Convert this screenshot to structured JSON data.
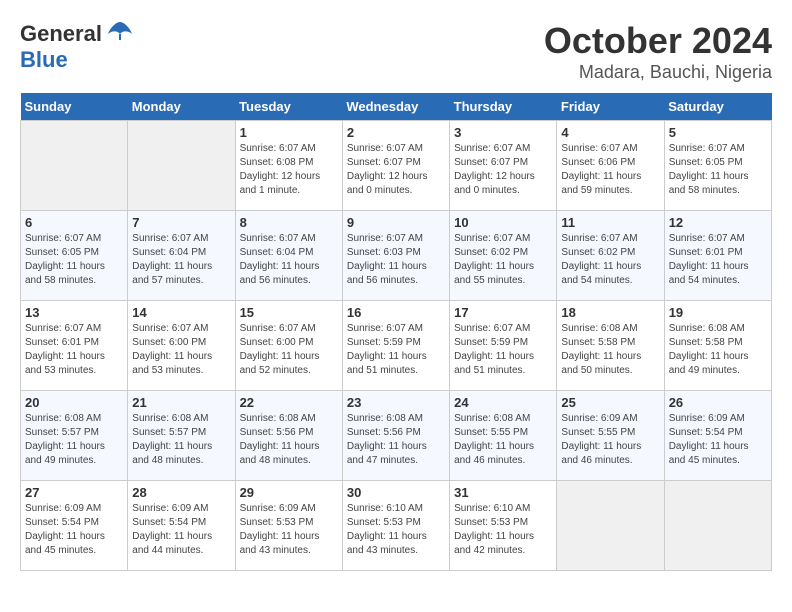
{
  "header": {
    "logo_general": "General",
    "logo_blue": "Blue",
    "month": "October 2024",
    "location": "Madara, Bauchi, Nigeria"
  },
  "days_of_week": [
    "Sunday",
    "Monday",
    "Tuesday",
    "Wednesday",
    "Thursday",
    "Friday",
    "Saturday"
  ],
  "weeks": [
    [
      {
        "day": "",
        "sunrise": "",
        "sunset": "",
        "daylight": "",
        "empty": true
      },
      {
        "day": "",
        "sunrise": "",
        "sunset": "",
        "daylight": "",
        "empty": true
      },
      {
        "day": "1",
        "sunrise": "Sunrise: 6:07 AM",
        "sunset": "Sunset: 6:08 PM",
        "daylight": "Daylight: 12 hours and 1 minute."
      },
      {
        "day": "2",
        "sunrise": "Sunrise: 6:07 AM",
        "sunset": "Sunset: 6:07 PM",
        "daylight": "Daylight: 12 hours and 0 minutes."
      },
      {
        "day": "3",
        "sunrise": "Sunrise: 6:07 AM",
        "sunset": "Sunset: 6:07 PM",
        "daylight": "Daylight: 12 hours and 0 minutes."
      },
      {
        "day": "4",
        "sunrise": "Sunrise: 6:07 AM",
        "sunset": "Sunset: 6:06 PM",
        "daylight": "Daylight: 11 hours and 59 minutes."
      },
      {
        "day": "5",
        "sunrise": "Sunrise: 6:07 AM",
        "sunset": "Sunset: 6:05 PM",
        "daylight": "Daylight: 11 hours and 58 minutes."
      }
    ],
    [
      {
        "day": "6",
        "sunrise": "Sunrise: 6:07 AM",
        "sunset": "Sunset: 6:05 PM",
        "daylight": "Daylight: 11 hours and 58 minutes."
      },
      {
        "day": "7",
        "sunrise": "Sunrise: 6:07 AM",
        "sunset": "Sunset: 6:04 PM",
        "daylight": "Daylight: 11 hours and 57 minutes."
      },
      {
        "day": "8",
        "sunrise": "Sunrise: 6:07 AM",
        "sunset": "Sunset: 6:04 PM",
        "daylight": "Daylight: 11 hours and 56 minutes."
      },
      {
        "day": "9",
        "sunrise": "Sunrise: 6:07 AM",
        "sunset": "Sunset: 6:03 PM",
        "daylight": "Daylight: 11 hours and 56 minutes."
      },
      {
        "day": "10",
        "sunrise": "Sunrise: 6:07 AM",
        "sunset": "Sunset: 6:02 PM",
        "daylight": "Daylight: 11 hours and 55 minutes."
      },
      {
        "day": "11",
        "sunrise": "Sunrise: 6:07 AM",
        "sunset": "Sunset: 6:02 PM",
        "daylight": "Daylight: 11 hours and 54 minutes."
      },
      {
        "day": "12",
        "sunrise": "Sunrise: 6:07 AM",
        "sunset": "Sunset: 6:01 PM",
        "daylight": "Daylight: 11 hours and 54 minutes."
      }
    ],
    [
      {
        "day": "13",
        "sunrise": "Sunrise: 6:07 AM",
        "sunset": "Sunset: 6:01 PM",
        "daylight": "Daylight: 11 hours and 53 minutes."
      },
      {
        "day": "14",
        "sunrise": "Sunrise: 6:07 AM",
        "sunset": "Sunset: 6:00 PM",
        "daylight": "Daylight: 11 hours and 53 minutes."
      },
      {
        "day": "15",
        "sunrise": "Sunrise: 6:07 AM",
        "sunset": "Sunset: 6:00 PM",
        "daylight": "Daylight: 11 hours and 52 minutes."
      },
      {
        "day": "16",
        "sunrise": "Sunrise: 6:07 AM",
        "sunset": "Sunset: 5:59 PM",
        "daylight": "Daylight: 11 hours and 51 minutes."
      },
      {
        "day": "17",
        "sunrise": "Sunrise: 6:07 AM",
        "sunset": "Sunset: 5:59 PM",
        "daylight": "Daylight: 11 hours and 51 minutes."
      },
      {
        "day": "18",
        "sunrise": "Sunrise: 6:08 AM",
        "sunset": "Sunset: 5:58 PM",
        "daylight": "Daylight: 11 hours and 50 minutes."
      },
      {
        "day": "19",
        "sunrise": "Sunrise: 6:08 AM",
        "sunset": "Sunset: 5:58 PM",
        "daylight": "Daylight: 11 hours and 49 minutes."
      }
    ],
    [
      {
        "day": "20",
        "sunrise": "Sunrise: 6:08 AM",
        "sunset": "Sunset: 5:57 PM",
        "daylight": "Daylight: 11 hours and 49 minutes."
      },
      {
        "day": "21",
        "sunrise": "Sunrise: 6:08 AM",
        "sunset": "Sunset: 5:57 PM",
        "daylight": "Daylight: 11 hours and 48 minutes."
      },
      {
        "day": "22",
        "sunrise": "Sunrise: 6:08 AM",
        "sunset": "Sunset: 5:56 PM",
        "daylight": "Daylight: 11 hours and 48 minutes."
      },
      {
        "day": "23",
        "sunrise": "Sunrise: 6:08 AM",
        "sunset": "Sunset: 5:56 PM",
        "daylight": "Daylight: 11 hours and 47 minutes."
      },
      {
        "day": "24",
        "sunrise": "Sunrise: 6:08 AM",
        "sunset": "Sunset: 5:55 PM",
        "daylight": "Daylight: 11 hours and 46 minutes."
      },
      {
        "day": "25",
        "sunrise": "Sunrise: 6:09 AM",
        "sunset": "Sunset: 5:55 PM",
        "daylight": "Daylight: 11 hours and 46 minutes."
      },
      {
        "day": "26",
        "sunrise": "Sunrise: 6:09 AM",
        "sunset": "Sunset: 5:54 PM",
        "daylight": "Daylight: 11 hours and 45 minutes."
      }
    ],
    [
      {
        "day": "27",
        "sunrise": "Sunrise: 6:09 AM",
        "sunset": "Sunset: 5:54 PM",
        "daylight": "Daylight: 11 hours and 45 minutes."
      },
      {
        "day": "28",
        "sunrise": "Sunrise: 6:09 AM",
        "sunset": "Sunset: 5:54 PM",
        "daylight": "Daylight: 11 hours and 44 minutes."
      },
      {
        "day": "29",
        "sunrise": "Sunrise: 6:09 AM",
        "sunset": "Sunset: 5:53 PM",
        "daylight": "Daylight: 11 hours and 43 minutes."
      },
      {
        "day": "30",
        "sunrise": "Sunrise: 6:10 AM",
        "sunset": "Sunset: 5:53 PM",
        "daylight": "Daylight: 11 hours and 43 minutes."
      },
      {
        "day": "31",
        "sunrise": "Sunrise: 6:10 AM",
        "sunset": "Sunset: 5:53 PM",
        "daylight": "Daylight: 11 hours and 42 minutes."
      },
      {
        "day": "",
        "sunrise": "",
        "sunset": "",
        "daylight": "",
        "empty": true
      },
      {
        "day": "",
        "sunrise": "",
        "sunset": "",
        "daylight": "",
        "empty": true
      }
    ]
  ]
}
